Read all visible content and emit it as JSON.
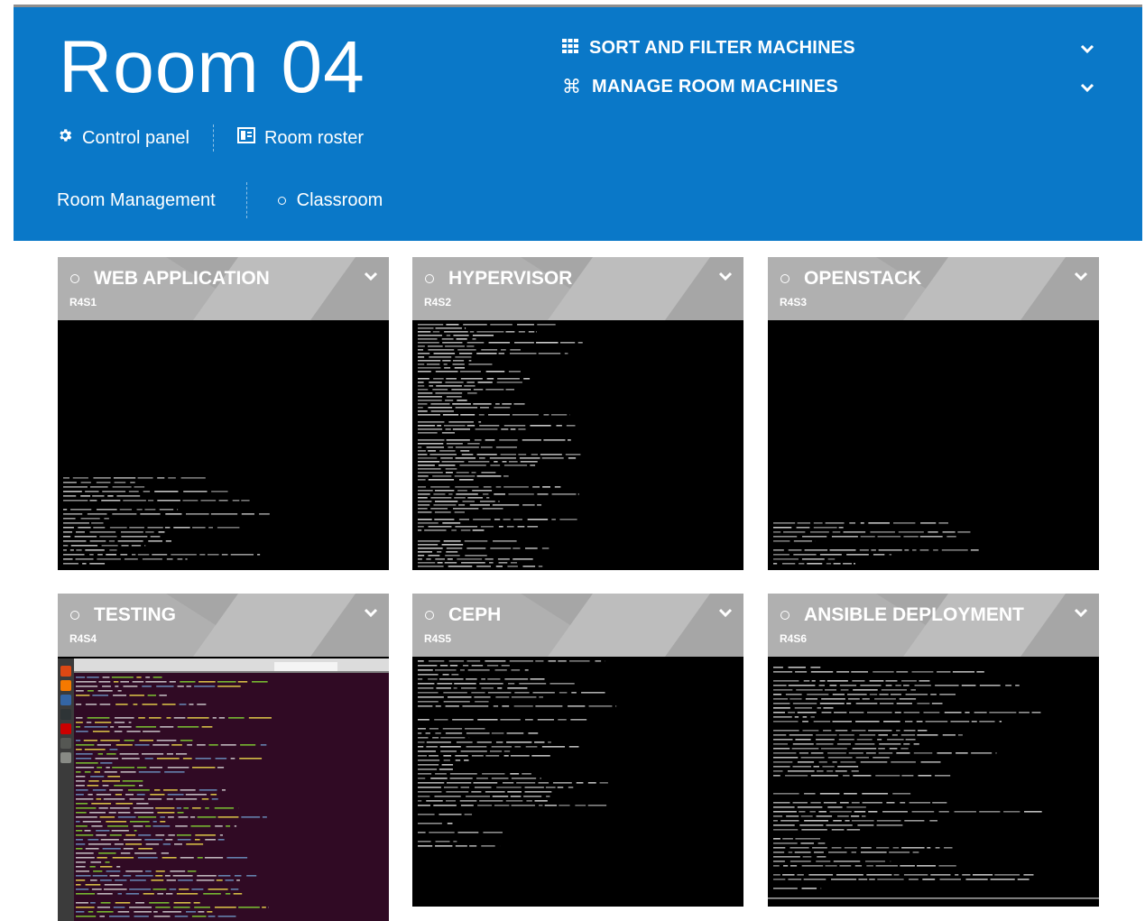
{
  "header": {
    "title": "Room 04",
    "nav": {
      "control_panel": "Control panel",
      "room_roster": "Room roster",
      "room_management": "Room Management",
      "classroom": "Classroom"
    },
    "menus": {
      "sort_filter": "SORT AND FILTER MACHINES",
      "manage": "MANAGE ROOM MACHINES"
    }
  },
  "colors": {
    "header_bg": "#0a78c8",
    "card_header_bg": "#b0b0b0",
    "terminal_bg": "#000000",
    "ubuntu_desktop_bg": "#300a24"
  },
  "icons": {
    "sort_filter": "grid-icon",
    "manage": "command-icon",
    "control_panel": "gear-icon",
    "room_roster": "roster-icon"
  },
  "machines": [
    {
      "name": "WEB APPLICATION",
      "id": "R4S1",
      "screen": "terminal"
    },
    {
      "name": "HYPERVISOR",
      "id": "R4S2",
      "screen": "terminal"
    },
    {
      "name": "OPENSTACK",
      "id": "R4S3",
      "screen": "terminal"
    },
    {
      "name": "TESTING",
      "id": "R4S4",
      "screen": "ubuntu-desktop"
    },
    {
      "name": "CEPH",
      "id": "R4S5",
      "screen": "terminal"
    },
    {
      "name": "ANSIBLE DEPLOYMENT",
      "id": "R4S6",
      "screen": "terminal"
    }
  ]
}
